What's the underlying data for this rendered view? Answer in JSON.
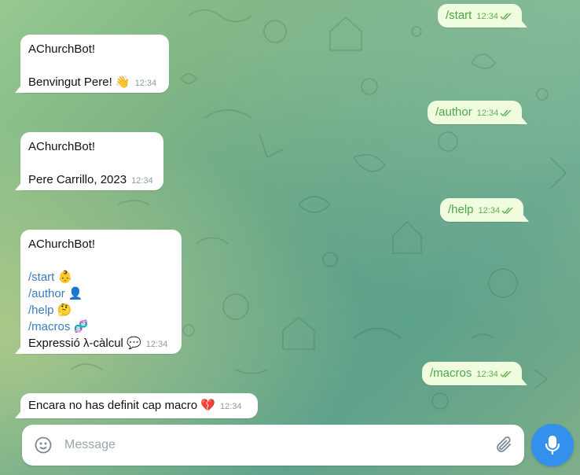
{
  "colors": {
    "accent": "#3390ec",
    "outgoing_bubble": "#effdde",
    "incoming_bubble": "#ffffff",
    "command_link": "#3b7cbd",
    "outgoing_text": "#4da64a"
  },
  "messages": [
    {
      "dir": "out",
      "text": "/start",
      "time": "12:34"
    },
    {
      "dir": "in",
      "title": "AChurchBot!",
      "body": "Benvingut Pere! ",
      "emoji": "👋",
      "time": "12:34"
    },
    {
      "dir": "out",
      "text": "/author",
      "time": "12:34"
    },
    {
      "dir": "in",
      "title": "AChurchBot!",
      "body": "Pere Carrillo, 2023",
      "time": "12:34"
    },
    {
      "dir": "out",
      "text": "/help",
      "time": "12:34"
    },
    {
      "dir": "in",
      "title": "AChurchBot!",
      "commands": [
        {
          "cmd": "/start",
          "emoji": "👶",
          "icon": "baby-emoji-icon"
        },
        {
          "cmd": "/author",
          "emoji": "👤",
          "icon": "bust-emoji-icon"
        },
        {
          "cmd": "/help",
          "emoji": "🤔",
          "icon": "thinking-emoji-icon"
        },
        {
          "cmd": "/macros",
          "emoji": "🧬",
          "icon": "dna-emoji-icon"
        }
      ],
      "footer": "Expressió λ-càlcul",
      "footer_emoji": "💬",
      "time": "12:34"
    },
    {
      "dir": "out",
      "text": "/macros",
      "time": "12:34"
    },
    {
      "dir": "in",
      "body": "Encara no has definit cap macro ",
      "emoji": "💔",
      "time": "12:34"
    }
  ],
  "composer": {
    "placeholder": "Message",
    "value": "",
    "left_icon": "smile-icon",
    "right_icon": "paperclip-icon",
    "send_icon": "microphone-icon"
  }
}
